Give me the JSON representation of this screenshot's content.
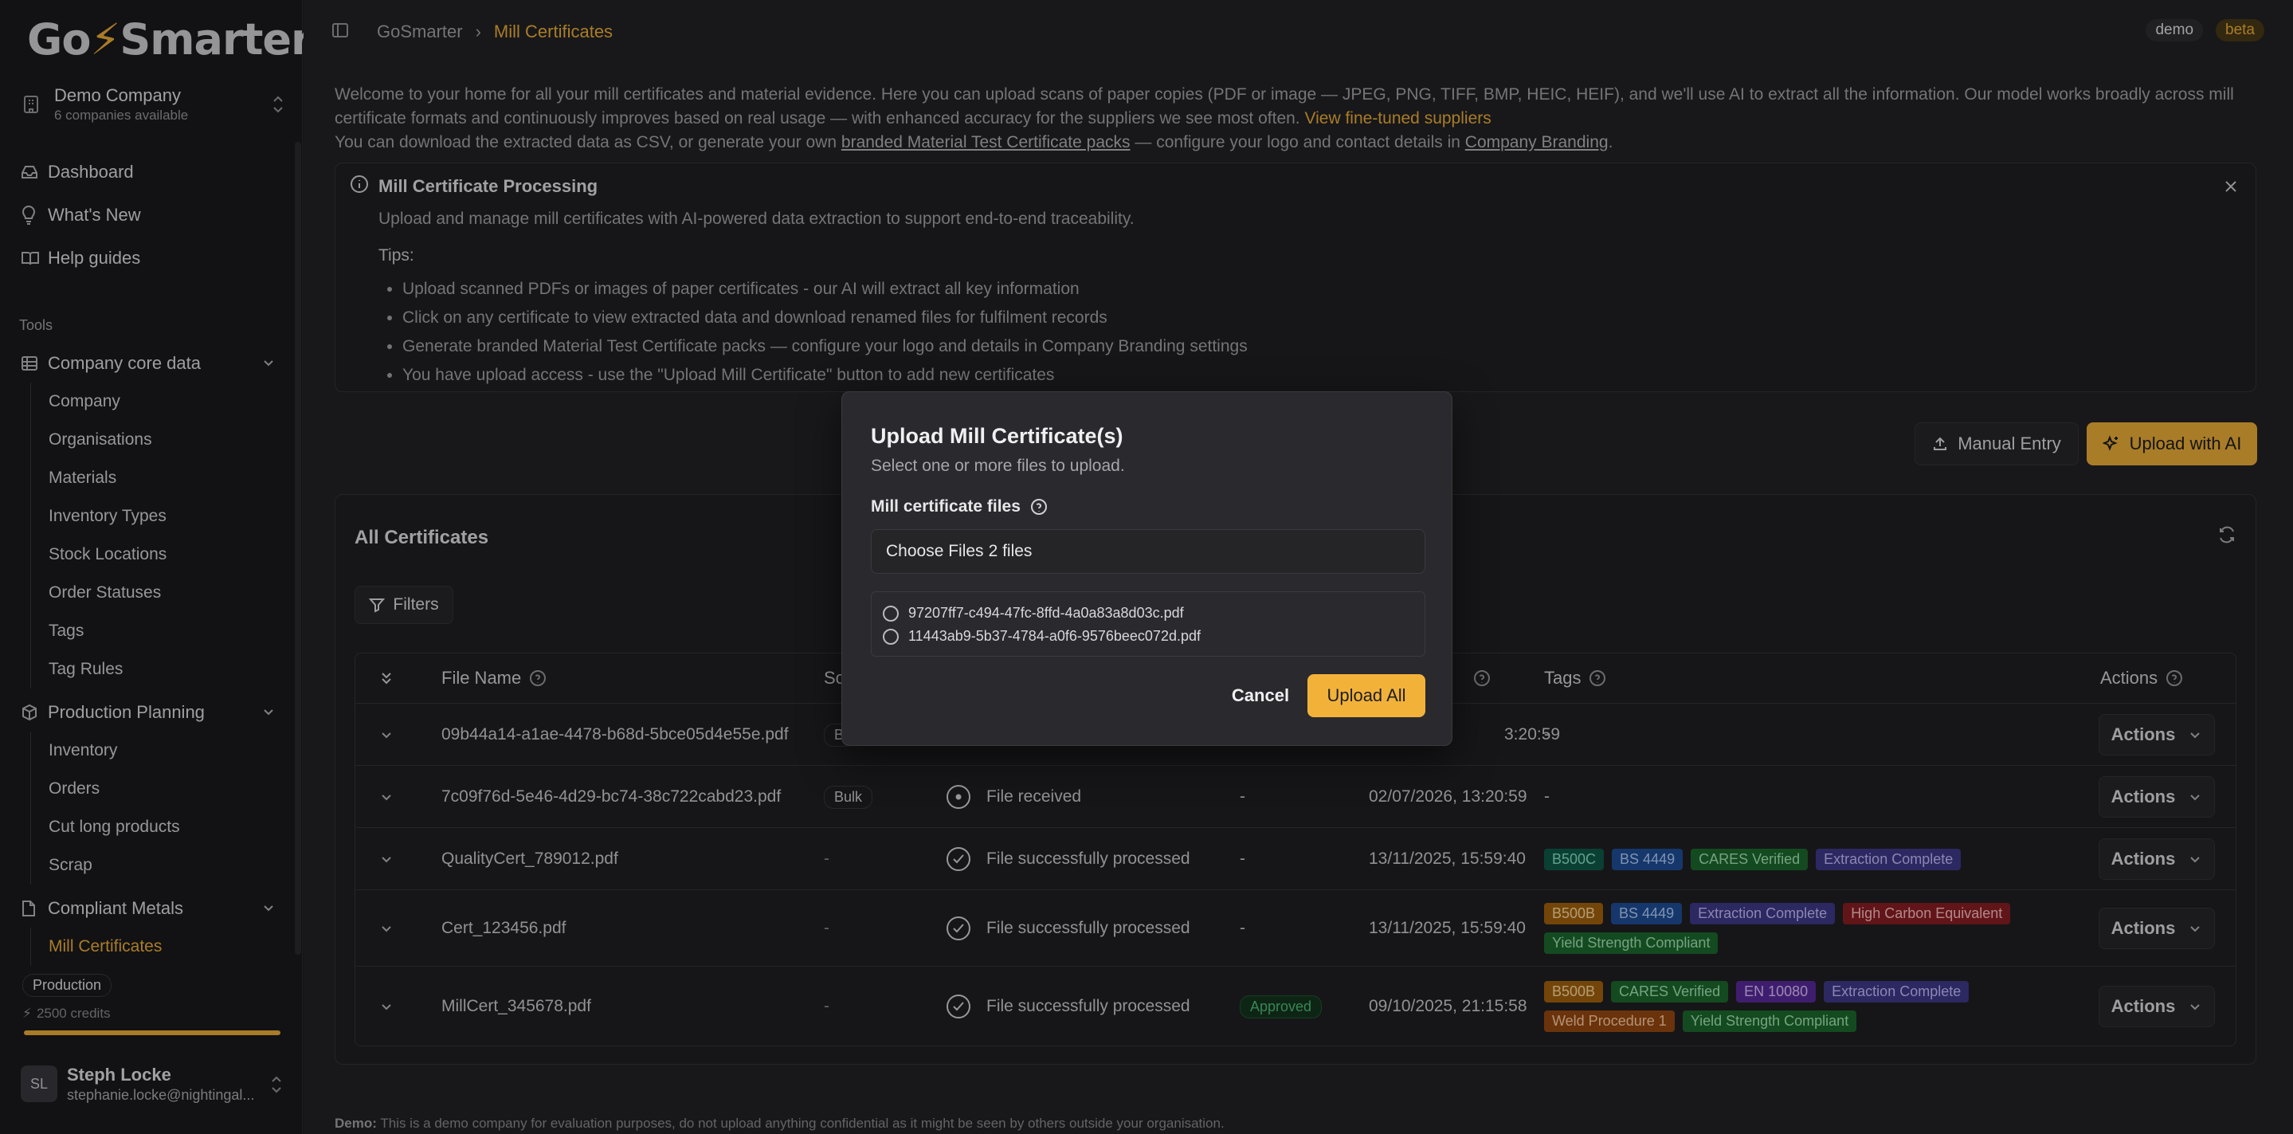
{
  "brand": {
    "logo_text_1": "Go",
    "logo_text_2": "Smarter",
    "accent": "#f2b23a"
  },
  "company": {
    "name": "Demo Company",
    "available": "6 companies available"
  },
  "nav": {
    "top": [
      {
        "label": "Dashboard",
        "icon": "inbox-icon"
      },
      {
        "label": "What's New",
        "icon": "lightbulb-icon"
      },
      {
        "label": "Help guides",
        "icon": "book-icon"
      }
    ],
    "tools_label": "Tools",
    "groups": [
      {
        "label": "Company core data",
        "items": [
          "Company",
          "Organisations",
          "Materials",
          "Inventory Types",
          "Stock Locations",
          "Order Statuses",
          "Tags",
          "Tag Rules"
        ]
      },
      {
        "label": "Production Planning",
        "items": [
          "Inventory",
          "Orders",
          "Cut long products",
          "Scrap"
        ]
      },
      {
        "label": "Compliant Metals",
        "items": [
          "Mill Certificates"
        ]
      }
    ]
  },
  "plan": {
    "name": "Production",
    "credits": "2500 credits",
    "credits_fill": 1.0
  },
  "user": {
    "initials": "SL",
    "name": "Steph Locke",
    "email": "stephanie.locke@nightingal..."
  },
  "breadcrumb": {
    "root": "GoSmarter",
    "current": "Mill Certificates"
  },
  "env": {
    "demo": "demo",
    "beta": "beta"
  },
  "welcome": {
    "line1": "Welcome to your home for all your mill certificates and material evidence. Here you can upload scans of paper copies (PDF or image — JPEG, PNG, TIFF, BMP, HEIC, HEIF), and we'll use AI to extract all the information. Our model works broadly across mill certificate formats and continuously improves based on real usage — with enhanced accuracy for the suppliers we see most often.",
    "link1": "View fine-tuned suppliers",
    "line2a": "You can download the extracted data as CSV, or generate your own",
    "link2": "branded Material Test Certificate packs",
    "line2b": "— configure your logo and contact details in",
    "link3": "Company Branding",
    "line2c": "."
  },
  "info": {
    "title": "Mill Certificate Processing",
    "desc": "Upload and manage mill certificates with AI-powered data extraction to support end-to-end traceability.",
    "tips_label": "Tips:",
    "tips": [
      "Upload scanned PDFs or images of paper certificates - our AI will extract all key information",
      "Click on any certificate to view extracted data and download renamed files for fulfilment records",
      "Generate branded Material Test Certificate packs — configure your logo and details in Company Branding settings",
      "You have upload access - use the \"Upload Mill Certificate\" button to add new certificates"
    ]
  },
  "buttons": {
    "manual_entry": "Manual Entry",
    "upload_ai": "Upload with AI",
    "filters": "Filters",
    "actions": "Actions"
  },
  "certs": {
    "title": "All Certificates",
    "columns": {
      "file_name": "File Name",
      "source": "So",
      "tags": "Tags",
      "actions": "Actions"
    },
    "rows": [
      {
        "file": "09b44a14-a1ae-4478-b68d-5bce05d4e55e.pdf",
        "source": "B",
        "status": "",
        "approval": "",
        "date": "3:20:59",
        "tags": [],
        "tags_empty": "-"
      },
      {
        "file": "7c09f76d-5e46-4d29-bc74-38c722cabd23.pdf",
        "source": "Bulk",
        "status": "File received",
        "approval": "-",
        "date": "02/07/2026, 13:20:59",
        "tags": [],
        "tags_empty": "-"
      },
      {
        "file": "QualityCert_789012.pdf",
        "source": "-",
        "status": "File successfully processed",
        "approval": "-",
        "date": "13/11/2025, 15:59:40",
        "tags": [
          {
            "t": "B500C",
            "c": "teal"
          },
          {
            "t": "BS 4449",
            "c": "blue"
          },
          {
            "t": "CARES Verified",
            "c": "green"
          },
          {
            "t": "Extraction Complete",
            "c": "indigo"
          }
        ]
      },
      {
        "file": "Cert_123456.pdf",
        "source": "-",
        "status": "File successfully processed",
        "approval": "-",
        "date": "13/11/2025, 15:59:40",
        "tags": [
          {
            "t": "B500B",
            "c": "amber"
          },
          {
            "t": "BS 4449",
            "c": "blue"
          },
          {
            "t": "Extraction Complete",
            "c": "indigo"
          },
          {
            "t": "High Carbon Equivalent",
            "c": "red"
          },
          {
            "t": "Yield Strength Compliant",
            "c": "green"
          }
        ]
      },
      {
        "file": "MillCert_345678.pdf",
        "source": "-",
        "status": "File successfully processed",
        "approval": "Approved",
        "date": "09/10/2025, 21:15:58",
        "tags": [
          {
            "t": "B500B",
            "c": "amber"
          },
          {
            "t": "CARES Verified",
            "c": "green"
          },
          {
            "t": "EN 10080",
            "c": "violet"
          },
          {
            "t": "Extraction Complete",
            "c": "indigo"
          },
          {
            "t": "Weld Procedure 1",
            "c": "orange"
          },
          {
            "t": "Yield Strength Compliant",
            "c": "green"
          }
        ]
      }
    ]
  },
  "tag_colors": {
    "teal": {
      "bg": "#0f5c4a",
      "fg": "#8ee6c8"
    },
    "blue": {
      "bg": "#1f4f9a",
      "fg": "#b8d2ff"
    },
    "green": {
      "bg": "#1e6a2e",
      "fg": "#a7e8b6"
    },
    "indigo": {
      "bg": "#403a8c",
      "fg": "#c8c2ff"
    },
    "amber": {
      "bg": "#a6640c",
      "fg": "#ffe0a8"
    },
    "red": {
      "bg": "#8c1f24",
      "fg": "#ffc2c5"
    },
    "violet": {
      "bg": "#5b2a9e",
      "fg": "#dcc6ff"
    },
    "orange": {
      "bg": "#9a4a10",
      "fg": "#ffd1a8"
    }
  },
  "modal": {
    "title": "Upload Mill Certificate(s)",
    "subtitle": "Select one or more files to upload.",
    "field_label": "Mill certificate files",
    "choose_btn": "Choose Files",
    "chosen": "2 files",
    "files": [
      "97207ff7-c494-47fc-8ffd-4a0a83a8d03c.pdf",
      "11443ab9-5b37-4784-a0f6-9576beec072d.pdf"
    ],
    "cancel": "Cancel",
    "upload_all": "Upload All"
  },
  "footer": {
    "label": "Demo:",
    "text": "This is a demo company for evaluation purposes, do not upload anything confidential as it might be seen by others outside your organisation."
  }
}
